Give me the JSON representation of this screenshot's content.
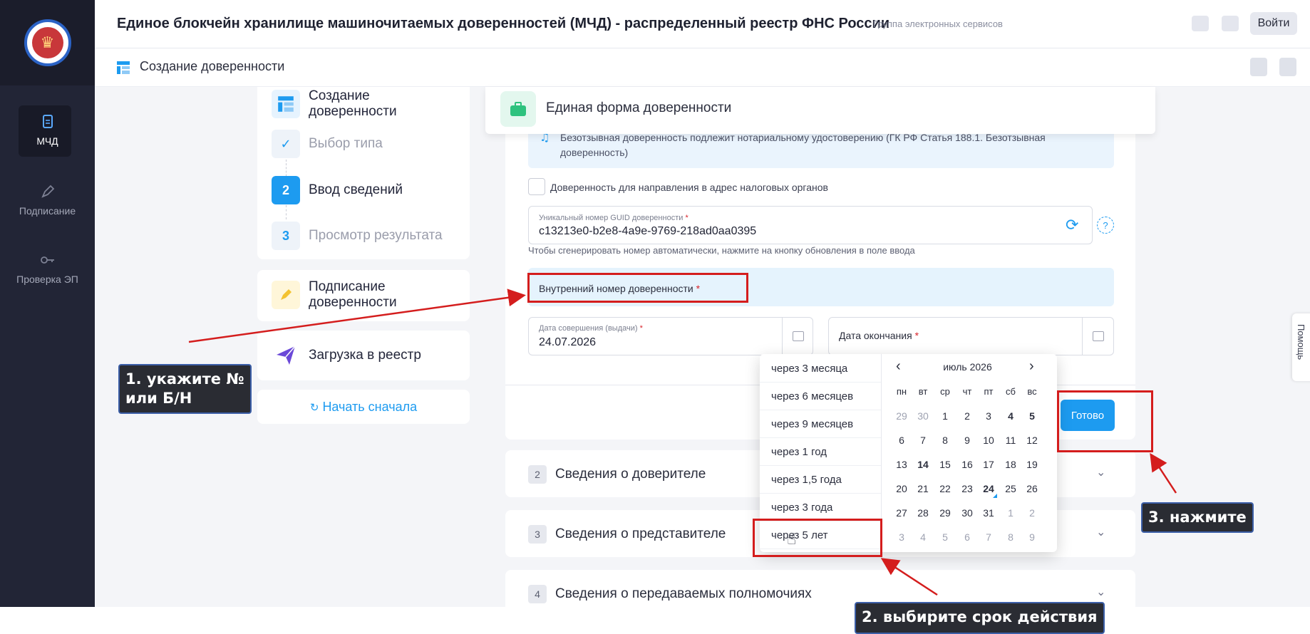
{
  "header": {
    "title": "Единое блокчейн хранилище машиночитаемых доверенностей (МЧД) - распределенный реестр ФНС России",
    "subtitle": "Группа электронных сервисов",
    "login_label": "Войти"
  },
  "sidebar": {
    "items": [
      {
        "label": "МЧД",
        "icon": "document-icon",
        "active": true
      },
      {
        "label": "Подписание",
        "icon": "pen-icon",
        "active": false
      },
      {
        "label": "Проверка ЭП",
        "icon": "key-icon",
        "active": false
      }
    ]
  },
  "subheader": {
    "title": "Создание доверенности"
  },
  "steps": {
    "create": {
      "label_line1": "Создание",
      "label_line2": "доверенности"
    },
    "items": [
      {
        "marker": "✓",
        "label": "Выбор типа"
      },
      {
        "marker": "2",
        "label": "Ввод сведений"
      },
      {
        "marker": "3",
        "label": "Просмотр результата"
      }
    ],
    "sign": {
      "label_line1": "Подписание",
      "label_line2": "доверенности"
    },
    "upload": {
      "label": "Загрузка в реестр"
    },
    "restart": {
      "label": "Начать сначала"
    }
  },
  "form": {
    "title": "Единая форма доверенности",
    "notice_text": "Безотзывная доверенность подлежит нотариальному удостоверению (ГК РФ Статья 188.1. Безотзывная доверенность)",
    "tax_checkbox_label": "Доверенность для направления в адрес налоговых органов",
    "guid_label": "Уникальный номер GUID доверенности",
    "guid_value": "c13213e0-b2e8-4a9e-9769-218ad0aa0395",
    "guid_hint": "Чтобы сгенерировать номер автоматически, нажмите на кнопку обновления в поле ввода",
    "internal_number_label": "Внутренний номер доверенности",
    "issue_date_label": "Дата совершения (выдачи)",
    "issue_date_value": "24.07.2026",
    "end_date_label": "Дата окончания",
    "required_mark": "*",
    "done_label": "Готово",
    "help_label": "?"
  },
  "sections": [
    {
      "num": "2",
      "title": "Сведения о доверителе"
    },
    {
      "num": "3",
      "title": "Сведения о представителе"
    },
    {
      "num": "4",
      "title": "Сведения о передаваемых полномочиях"
    }
  ],
  "datepicker": {
    "presets": [
      "через 3 месяца",
      "через 6 месяцев",
      "через 9 месяцев",
      "через 1 год",
      "через 1,5 года",
      "через 3 года",
      "через 5 лет"
    ],
    "month_label": "июль 2026",
    "weekdays": [
      "пн",
      "вт",
      "ср",
      "чт",
      "пт",
      "сб",
      "вс"
    ],
    "weeks": [
      [
        "29",
        "30",
        "1",
        "2",
        "3",
        "4",
        "5"
      ],
      [
        "6",
        "7",
        "8",
        "9",
        "10",
        "11",
        "12"
      ],
      [
        "13",
        "14",
        "15",
        "16",
        "17",
        "18",
        "19"
      ],
      [
        "20",
        "21",
        "22",
        "23",
        "24",
        "25",
        "26"
      ],
      [
        "27",
        "28",
        "29",
        "30",
        "31",
        "1",
        "2"
      ],
      [
        "3",
        "4",
        "5",
        "6",
        "7",
        "8",
        "9"
      ]
    ],
    "today": "24"
  },
  "help_tab": {
    "label": "Помощь"
  },
  "annotations": {
    "callout1": "1. укажите №\nили Б/Н",
    "callout2": "2. выбирите срок действия",
    "callout3": "3. нажмите"
  },
  "colors": {
    "sidebar_bg": "#222536",
    "accent_blue": "#1d9bf0",
    "annotation_red": "#d41d1d",
    "callout_bg": "#2a2c33"
  }
}
